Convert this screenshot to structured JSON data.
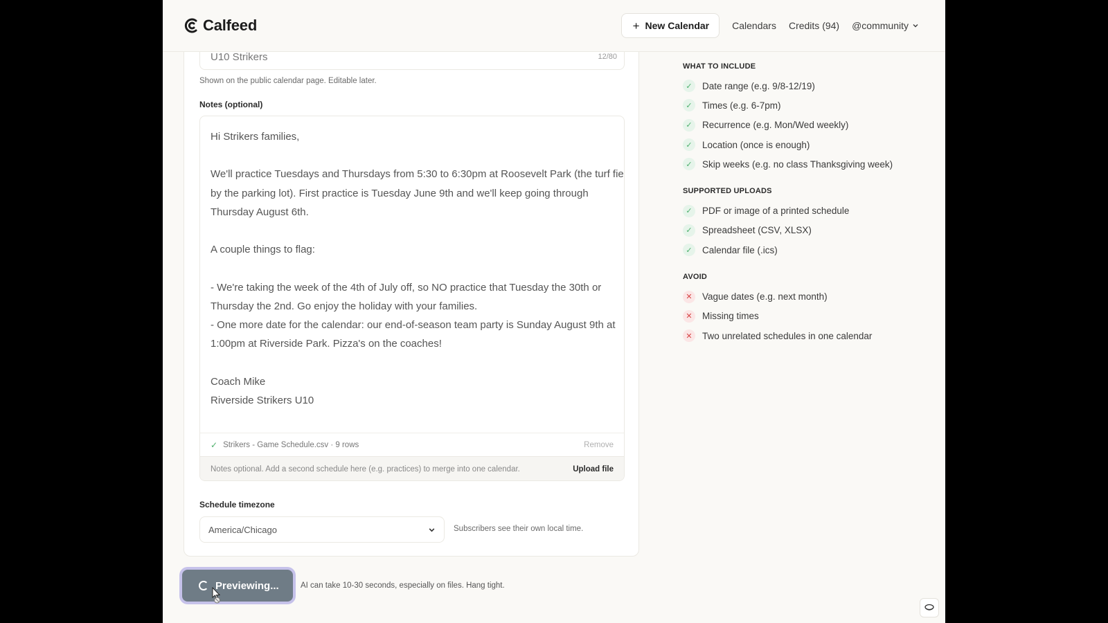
{
  "header": {
    "brand": "Calfeed",
    "new_calendar": "New Calendar",
    "calendars": "Calendars",
    "credits": "Credits (94)",
    "user": "@community"
  },
  "form": {
    "name_value": "U10 Strikers",
    "name_count": "12/80",
    "name_helper": "Shown on the public calendar page. Editable later.",
    "notes_label": "Notes (optional)",
    "notes_value": "Hi Strikers families,\n\nWe'll practice Tuesdays and Thursdays from 5:30 to 6:30pm at Roosevelt Park (the turf field by the parking lot). First practice is Tuesday June 9th and we'll keep going through Thursday August 6th.\n\nA couple things to flag:\n\n- We're taking the week of the 4th of July off, so NO practice that Tuesday the 30th or Thursday the 2nd. Go enjoy the holiday with your families.\n- One more date for the calendar: our end-of-season team party is Sunday August 9th at 1:00pm at Riverside Park. Pizza's on the coaches!\n\nCoach Mike\nRiverside Strikers U10",
    "file_name": "Strikers - Game Schedule.csv · 9 rows",
    "remove": "Remove",
    "upload_hint": "Notes optional. Add a second schedule here (e.g. practices) to merge into one calendar.",
    "upload_file": "Upload file",
    "timezone_label": "Schedule timezone",
    "timezone_value": "America/Chicago",
    "timezone_hint": "Subscribers see their own local time."
  },
  "preview": {
    "button": "Previewing...",
    "hint": "AI can take 10-30 seconds, especially on files. Hang tight."
  },
  "tips": {
    "include_heading": "WHAT TO INCLUDE",
    "include": [
      "Date range (e.g. 9/8-12/19)",
      "Times (e.g. 6-7pm)",
      "Recurrence (e.g. Mon/Wed weekly)",
      "Location (once is enough)",
      "Skip weeks (e.g. no class Thanksgiving week)"
    ],
    "uploads_heading": "SUPPORTED UPLOADS",
    "uploads": [
      "PDF or image of a printed schedule",
      "Spreadsheet (CSV, XLSX)",
      "Calendar file (.ics)"
    ],
    "avoid_heading": "AVOID",
    "avoid": [
      "Vague dates (e.g. next month)",
      "Missing times",
      "Two unrelated schedules in one calendar"
    ]
  },
  "colors": {
    "accent_check": "#4caf6a",
    "accent_x": "#d64545",
    "preview_button": "#6f7c86"
  }
}
